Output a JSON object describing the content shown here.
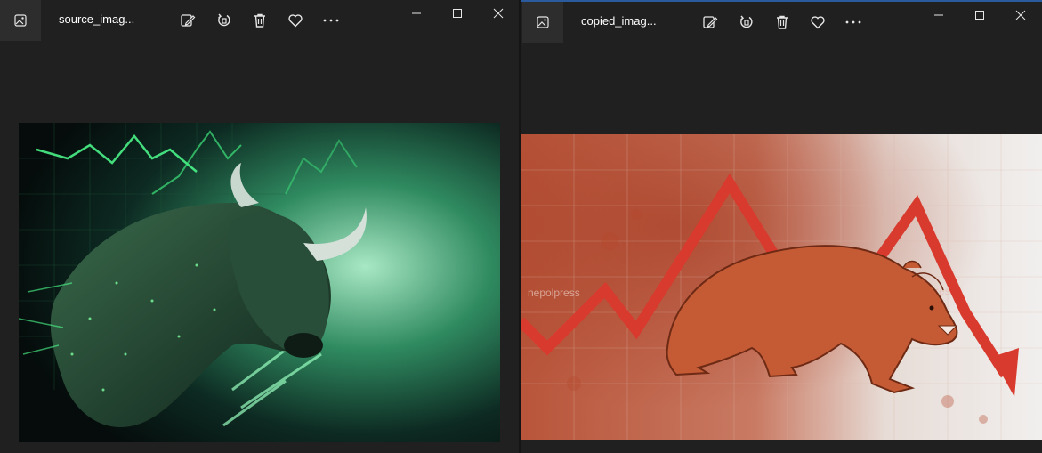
{
  "windows": {
    "left": {
      "title": "source_imag...",
      "image_alt": "Green neon bull charging over stock chart"
    },
    "right": {
      "title": "copied_imag...",
      "image_alt": "Red bear walking in front of falling stock arrow",
      "watermark": "nepolpress"
    }
  },
  "toolbar_icons": [
    "edit-image-icon",
    "rotate-icon",
    "delete-icon",
    "favorite-icon",
    "more-icon"
  ],
  "window_controls": [
    "minimize-icon",
    "maximize-icon",
    "close-icon"
  ],
  "colors": {
    "window_bg": "#202020",
    "titlebar_icon_bg": "#2d2d2d",
    "active_border": "#2a5b9e",
    "icon": "#e6e6e6"
  }
}
